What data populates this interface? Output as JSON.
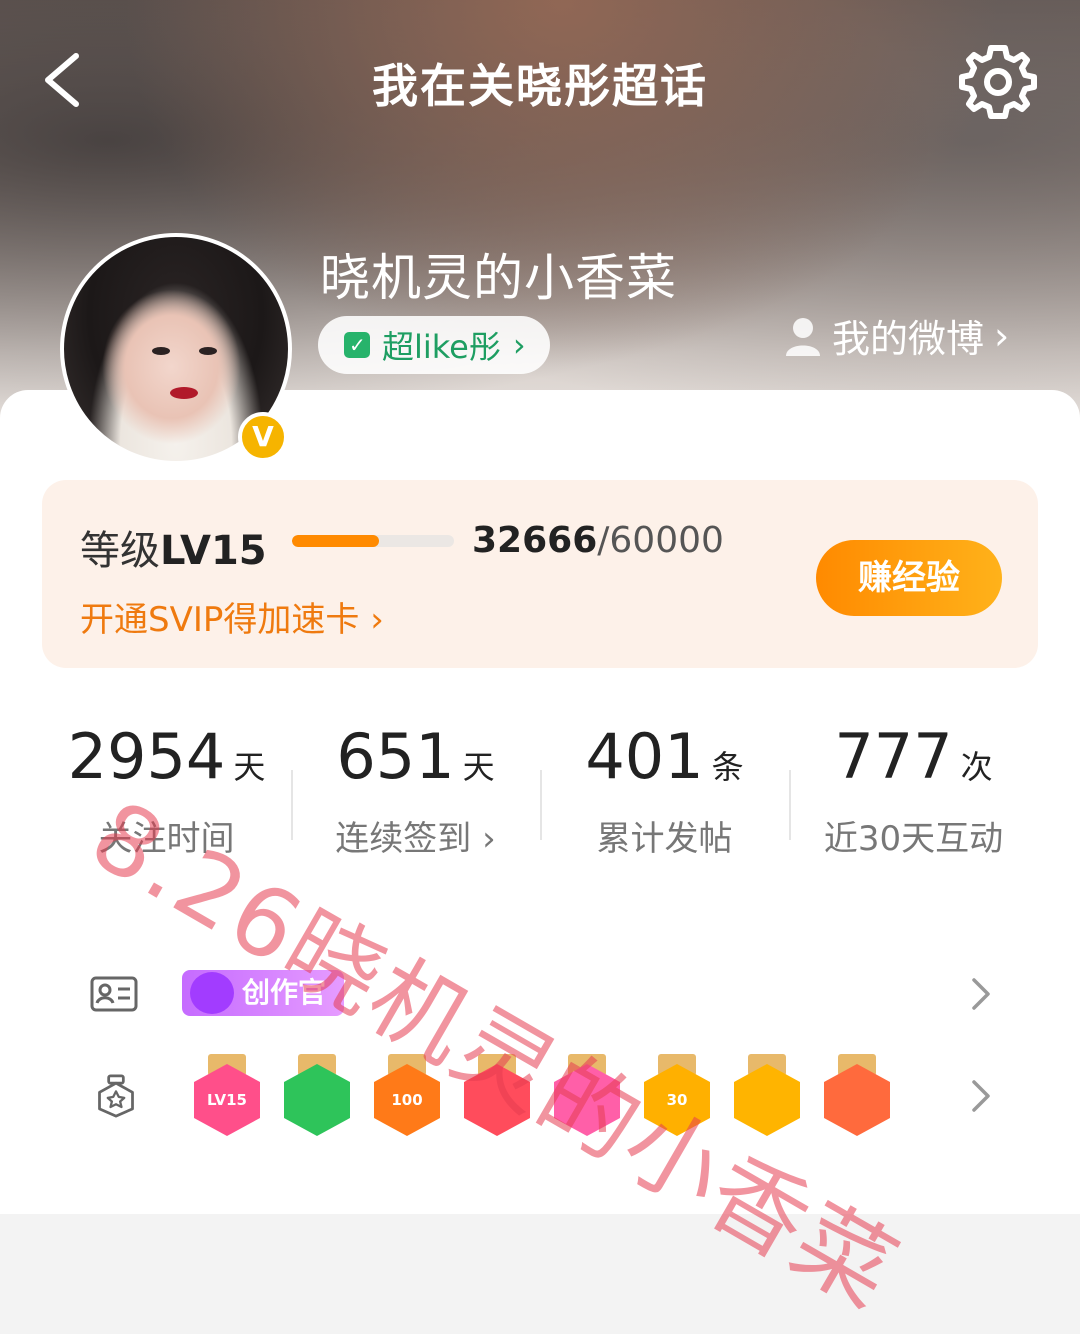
{
  "header": {
    "title": "我在关晓彤超话"
  },
  "profile": {
    "username": "晓机灵的小香菜",
    "verify_mark": "V",
    "chip_label": "超like彤",
    "myweibo_label": "我的微博"
  },
  "level": {
    "label_prefix": "等级",
    "level": "LV15",
    "exp_current": "32666",
    "exp_max": "/60000",
    "progress_fraction": 0.54,
    "svip_link": "开通SVIP得加速卡",
    "earn_button": "赚经验"
  },
  "stats": [
    {
      "value": "2954",
      "unit": "天",
      "label": "关注时间"
    },
    {
      "value": "651",
      "unit": "天",
      "label": "连续签到"
    },
    {
      "value": "401",
      "unit": "条",
      "label": "累计发帖"
    },
    {
      "value": "777",
      "unit": "次",
      "label": "近30天互动"
    }
  ],
  "badges": {
    "creator_label": "创作官",
    "medals": [
      {
        "text": "LV15",
        "color": "#ff4f8a"
      },
      {
        "text": "",
        "color": "#2ec45a"
      },
      {
        "text": "100",
        "color": "#ff7a18"
      },
      {
        "text": "",
        "color": "#ff4c5c"
      },
      {
        "text": "",
        "color": "#ff5fa8"
      },
      {
        "text": "30",
        "color": "#ffb000"
      },
      {
        "text": "",
        "color": "#ffb400"
      },
      {
        "text": "",
        "color": "#ff6a3d"
      }
    ]
  },
  "watermark": "8.26晓机灵的小香菜"
}
